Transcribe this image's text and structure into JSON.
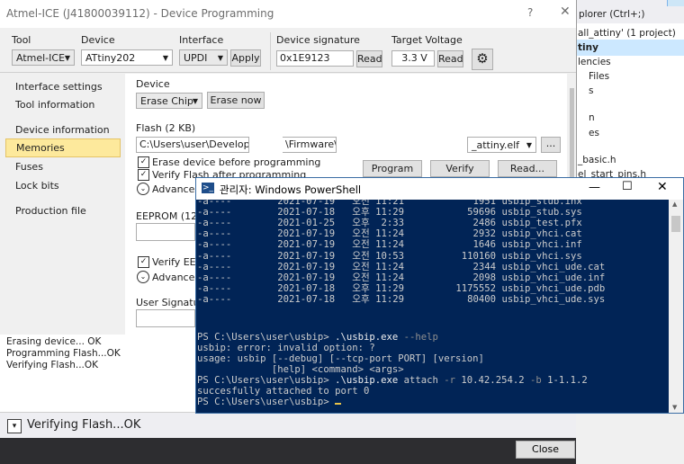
{
  "solution_explorer": {
    "header_text": "plorer (Ctrl+;)",
    "lines": [
      "all_attiny' (1 project)",
      "tiny",
      "lencies",
      "Files",
      "s",
      "n",
      "es",
      "_basic.h",
      "el_start_pins.h"
    ]
  },
  "output": {
    "lines": [
      "Erasing device... OK",
      "Programming Flash...OK",
      "Verifying Flash...OK"
    ]
  },
  "status": {
    "toggle_icon": "▾",
    "text": "Verifying Flash...OK",
    "close_label": "Close"
  },
  "dialog": {
    "title": "Atmel-ICE (J41800039112) - Device Programming",
    "help": "?",
    "close": "✕",
    "tool_label": "Tool",
    "tool_value": "Atmel-ICE",
    "device_label": "Device",
    "device_value": "ATtiny202",
    "interface_label": "Interface",
    "interface_value": "UPDI",
    "apply_label": "Apply",
    "signature_label": "Device signature",
    "signature_value": "0x1E9123",
    "signature_read": "Read",
    "voltage_label": "Target Voltage",
    "voltage_value": "3.3 V",
    "voltage_read": "Read",
    "nav": [
      "Interface settings",
      "Tool information",
      "Device information",
      "Memories",
      "Fuses",
      "Lock bits",
      "Production file"
    ],
    "device_group": "Device",
    "erase_combo": "Erase Chip",
    "erase_now": "Erase now",
    "flash_label": "Flash (2 KB)",
    "flash_path_a": "C:\\Users\\user\\Develop\\",
    "flash_path_b": "\\Firmware\\",
    "flash_path_c": "_attiny.elf",
    "browse": "...",
    "erase_before": "Erase device before programming",
    "verify_after": "Verify Flash after programming",
    "advanced": "Advanced",
    "program_btn": "Program",
    "verify_btn": "Verify",
    "read_btn": "Read...",
    "eeprom_label": "EEPROM (128",
    "verify_eep": "Verify EEP",
    "advanced2": "Advanced",
    "user_sig": "User Signature"
  },
  "powershell": {
    "title": "관리자: Windows PowerShell",
    "icon_glyph": ">_",
    "listing": [
      {
        "mode": "-a----",
        "date": "2021-07-19",
        "ampm": "오전",
        "time": "11:21",
        "size": "1951",
        "name": "usbip_stub.inx"
      },
      {
        "mode": "-a----",
        "date": "2021-07-18",
        "ampm": "오후",
        "time": "11:29",
        "size": "59696",
        "name": "usbip_stub.sys"
      },
      {
        "mode": "-a----",
        "date": "2021-01-25",
        "ampm": "오후",
        "time": "2:33",
        "size": "2486",
        "name": "usbip_test.pfx"
      },
      {
        "mode": "-a----",
        "date": "2021-07-19",
        "ampm": "오전",
        "time": "11:24",
        "size": "2932",
        "name": "usbip_vhci.cat"
      },
      {
        "mode": "-a----",
        "date": "2021-07-19",
        "ampm": "오전",
        "time": "11:24",
        "size": "1646",
        "name": "usbip_vhci.inf"
      },
      {
        "mode": "-a----",
        "date": "2021-07-19",
        "ampm": "오전",
        "time": "10:53",
        "size": "110160",
        "name": "usbip_vhci.sys"
      },
      {
        "mode": "-a----",
        "date": "2021-07-19",
        "ampm": "오전",
        "time": "11:24",
        "size": "2344",
        "name": "usbip_vhci_ude.cat"
      },
      {
        "mode": "-a----",
        "date": "2021-07-19",
        "ampm": "오전",
        "time": "11:24",
        "size": "2098",
        "name": "usbip_vhci_ude.inf"
      },
      {
        "mode": "-a----",
        "date": "2021-07-18",
        "ampm": "오후",
        "time": "11:29",
        "size": "1175552",
        "name": "usbip_vhci_ude.pdb"
      },
      {
        "mode": "-a----",
        "date": "2021-07-18",
        "ampm": "오후",
        "time": "11:29",
        "size": "80400",
        "name": "usbip_vhci_ude.sys"
      }
    ],
    "prompt": "PS C:\\Users\\user\\usbip> ",
    "cmd1_exe": ".\\usbip.exe",
    "cmd1_args": " --help",
    "out1": "usbip: error: invalid option: ?",
    "out2": "usage: usbip [--debug] [--tcp-port PORT] [version]",
    "out3": "             [help] <command> <args>",
    "cmd2_exe": ".\\usbip.exe",
    "cmd2_word": " attach",
    "cmd2_params": " -r ",
    "cmd2_ip": "10.42.254.2",
    "cmd2_b": " -b ",
    "cmd2_bus": "1-1.1.2",
    "out4": "succesfully attached to port 0",
    "colors": {
      "background": "#012456",
      "text": "#cccccc",
      "string": "#4fb2c8",
      "cursor": "#e8c24a"
    }
  }
}
